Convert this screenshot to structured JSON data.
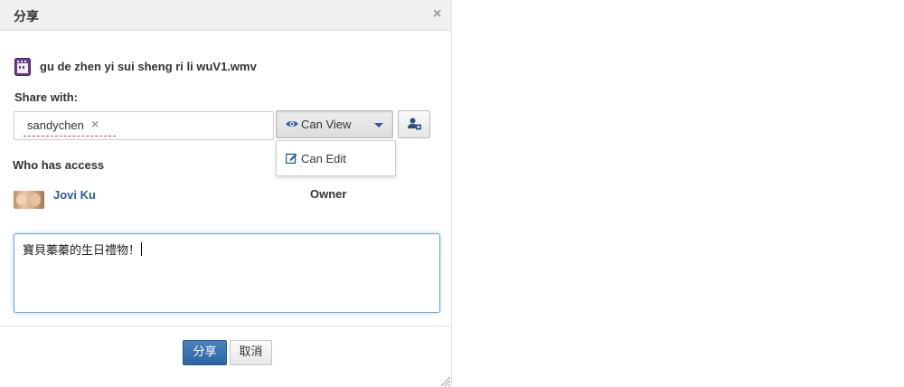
{
  "dialog": {
    "title": "分享",
    "close_symbol": "×"
  },
  "file": {
    "icon": "video-file-icon",
    "name": "gu de zhen yi sui sheng ri li wuV1.wmv"
  },
  "share": {
    "label": "Share with:",
    "recipient": "sandychen",
    "remove_symbol": "×",
    "permission_selected": "Can View",
    "permission_menu": [
      {
        "label": "Can Edit",
        "icon": "edit-icon"
      }
    ],
    "add_person_icon": "add-user-icon"
  },
  "access": {
    "label": "Who has access",
    "owner": {
      "name": "Jovi Ku",
      "role": "Owner"
    }
  },
  "message": {
    "value": "寶貝蓁蓁的生日禮物！"
  },
  "footer": {
    "share_label": "分享",
    "cancel_label": "取消"
  },
  "colors": {
    "accent": "#2a5c96",
    "primary_button": "#2d64a3",
    "focus_border": "#6fa6d6",
    "file_icon": "#6b3b86"
  }
}
